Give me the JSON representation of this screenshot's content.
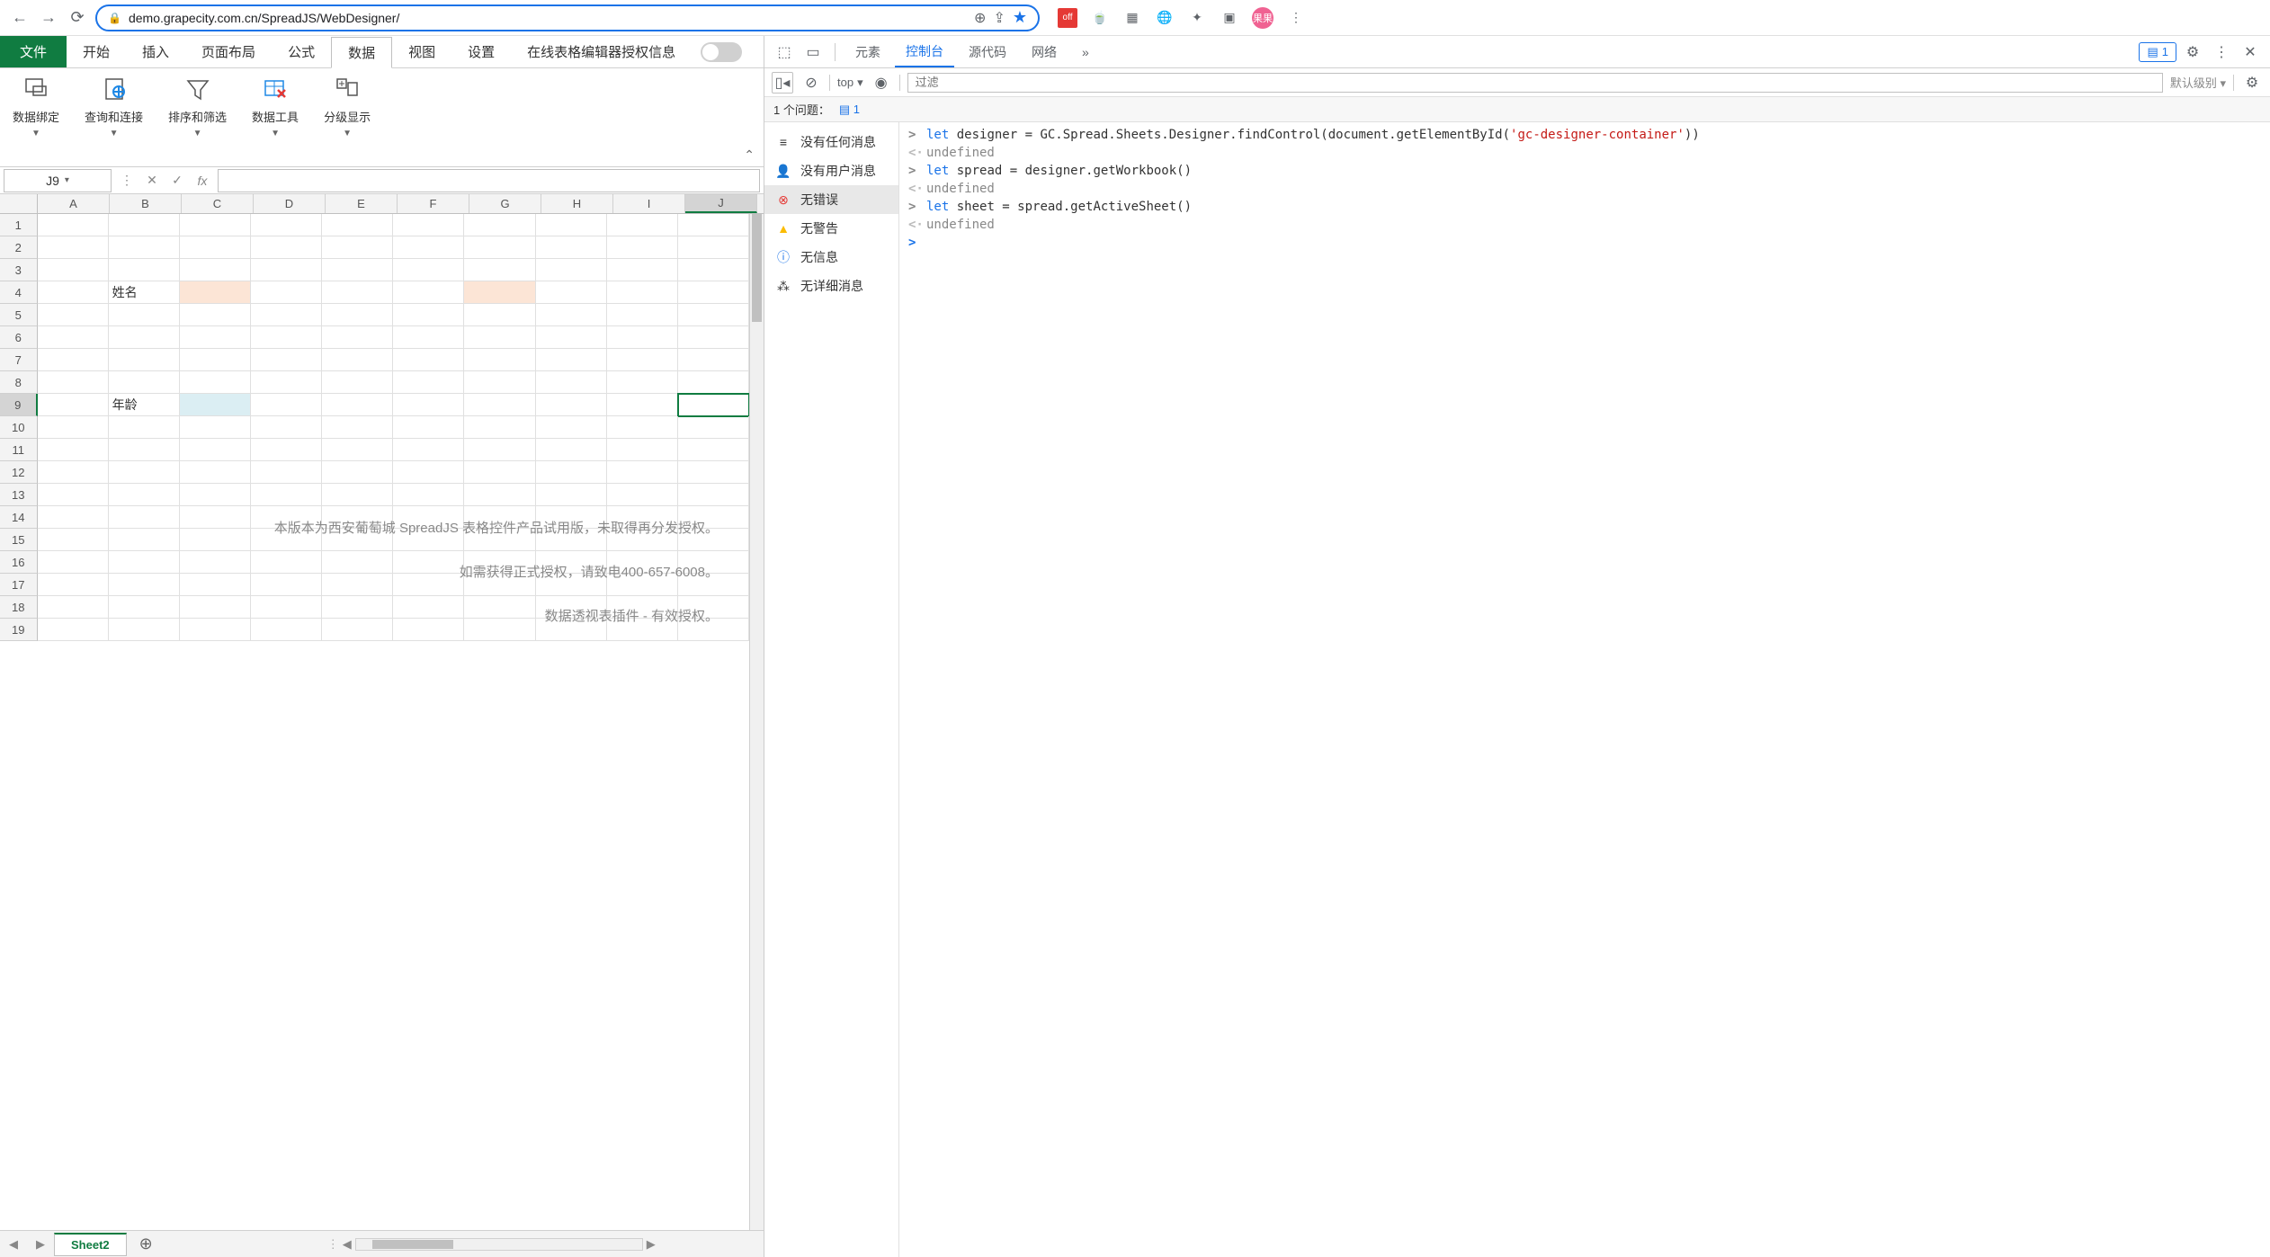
{
  "browser": {
    "url": "demo.grapecity.com.cn/SpreadJS/WebDesigner/",
    "profile": "果果",
    "ext_label": "off"
  },
  "ribbon": {
    "tabs": {
      "file": "文件",
      "home": "开始",
      "insert": "插入",
      "layout": "页面布局",
      "formula": "公式",
      "data": "数据",
      "view": "视图",
      "settings": "设置",
      "license": "在线表格编辑器授权信息"
    },
    "groups": {
      "data_binding": "数据绑定",
      "query_connect": "查询和连接",
      "sort_filter": "排序和筛选",
      "data_tools": "数据工具",
      "outline": "分级显示"
    }
  },
  "formula_bar": {
    "name_box": "J9",
    "fx": "fx",
    "value": ""
  },
  "sheet": {
    "columns": [
      "A",
      "B",
      "C",
      "D",
      "E",
      "F",
      "G",
      "H",
      "I",
      "J"
    ],
    "row_count": 19,
    "active_cell": {
      "row": 9,
      "col": "J"
    },
    "cells": {
      "B4": "姓名",
      "B9": "年龄"
    },
    "filled_orange": [
      "C4",
      "G4"
    ],
    "filled_blue": [
      "C9"
    ],
    "watermark": {
      "line1": "本版本为西安葡萄城 SpreadJS 表格控件产品试用版，未取得再分发授权。",
      "line2": "如需获得正式授权，请致电400-657-6008。",
      "line3": "数据透视表插件 - 有效授权。"
    },
    "tab_name": "Sheet2"
  },
  "devtools": {
    "tabs": {
      "elements": "元素",
      "console": "控制台",
      "sources": "源代码",
      "network": "网络"
    },
    "badge_count": "1",
    "toolbar": {
      "context": "top",
      "filter_placeholder": "过滤",
      "level": "默认级别"
    },
    "issues": {
      "label": "1 个问题：",
      "count": "1"
    },
    "sidebar": {
      "no_messages": "没有任何消息",
      "no_user_messages": "没有用户消息",
      "no_errors": "无错误",
      "no_warnings": "无警告",
      "no_info": "无信息",
      "no_verbose": "无详细消息"
    },
    "console_lines": [
      {
        "type": "input",
        "segments": [
          {
            "cls": "kw",
            "t": "let"
          },
          {
            "cls": "",
            "t": " designer = GC.Spread.Sheets.Designer.findControl(document.getElementById("
          },
          {
            "cls": "str",
            "t": "'gc-designer-container'"
          },
          {
            "cls": "",
            "t": "))"
          }
        ]
      },
      {
        "type": "result",
        "text": "undefined"
      },
      {
        "type": "input",
        "segments": [
          {
            "cls": "kw",
            "t": "let"
          },
          {
            "cls": "",
            "t": " spread = designer.getWorkbook()"
          }
        ]
      },
      {
        "type": "result",
        "text": "undefined"
      },
      {
        "type": "input",
        "segments": [
          {
            "cls": "kw",
            "t": "let"
          },
          {
            "cls": "",
            "t": " sheet = spread.getActiveSheet()"
          }
        ]
      },
      {
        "type": "result",
        "text": "undefined"
      },
      {
        "type": "prompt",
        "text": ""
      }
    ]
  }
}
